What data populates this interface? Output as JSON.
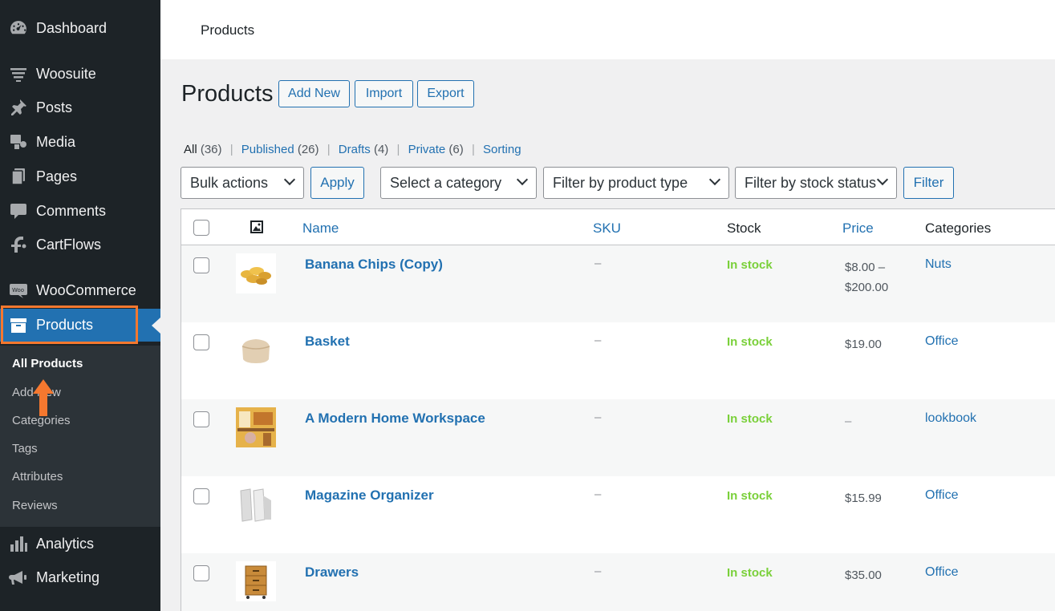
{
  "sidebar": {
    "items": [
      {
        "label": "Dashboard",
        "icon": "dashboard-icon"
      },
      {
        "label": "Woosuite",
        "icon": "woosuite-icon"
      },
      {
        "label": "Posts",
        "icon": "pushpin-icon"
      },
      {
        "label": "Media",
        "icon": "media-icon"
      },
      {
        "label": "Pages",
        "icon": "pages-icon"
      },
      {
        "label": "Comments",
        "icon": "comment-icon"
      },
      {
        "label": "CartFlows",
        "icon": "cartflows-icon"
      },
      {
        "label": "WooCommerce",
        "icon": "woocommerce-icon"
      },
      {
        "label": "Products",
        "icon": "archive-icon"
      },
      {
        "label": "Analytics",
        "icon": "bar-chart-icon"
      },
      {
        "label": "Marketing",
        "icon": "megaphone-icon"
      }
    ],
    "submenu": [
      "All Products",
      "Add New",
      "Categories",
      "Tags",
      "Attributes",
      "Reviews"
    ]
  },
  "topbar": {
    "title": "Products"
  },
  "heading": {
    "title": "Products",
    "add_new": "Add New",
    "import": "Import",
    "export": "Export"
  },
  "views": {
    "all": "All",
    "all_count": "(36)",
    "published": "Published",
    "published_count": "(26)",
    "drafts": "Drafts",
    "drafts_count": "(4)",
    "private": "Private",
    "private_count": "(6)",
    "sorting": "Sorting",
    "sep": "|"
  },
  "filters": {
    "bulk_actions": "Bulk actions",
    "apply": "Apply",
    "category": "Select a category",
    "product_type": "Filter by product type",
    "stock_status": "Filter by stock status",
    "filter": "Filter"
  },
  "table": {
    "columns": {
      "name": "Name",
      "sku": "SKU",
      "stock": "Stock",
      "price": "Price",
      "categories": "Categories"
    },
    "rows": [
      {
        "name": "Banana Chips (Copy)",
        "sku": "–",
        "stock": "In stock",
        "price_line1": "$8.00 –",
        "price_line2": "$200.00",
        "category": "Nuts"
      },
      {
        "name": "Basket",
        "sku": "–",
        "stock": "In stock",
        "price_line1": "$19.00",
        "price_line2": "",
        "category": "Office"
      },
      {
        "name": "A Modern Home Workspace",
        "sku": "–",
        "stock": "In stock",
        "price_line1": "–",
        "price_line2": "",
        "category": "lookbook"
      },
      {
        "name": "Magazine Organizer",
        "sku": "–",
        "stock": "In stock",
        "price_line1": "$15.99",
        "price_line2": "",
        "category": "Office"
      },
      {
        "name": "Drawers",
        "sku": "–",
        "stock": "In stock",
        "price_line1": "$35.00",
        "price_line2": "",
        "category": "Office"
      }
    ]
  },
  "colors": {
    "sidebar_bg": "#1d2327",
    "accent": "#2271b1",
    "highlight": "#f5782f",
    "in_stock": "#7ad03a"
  }
}
